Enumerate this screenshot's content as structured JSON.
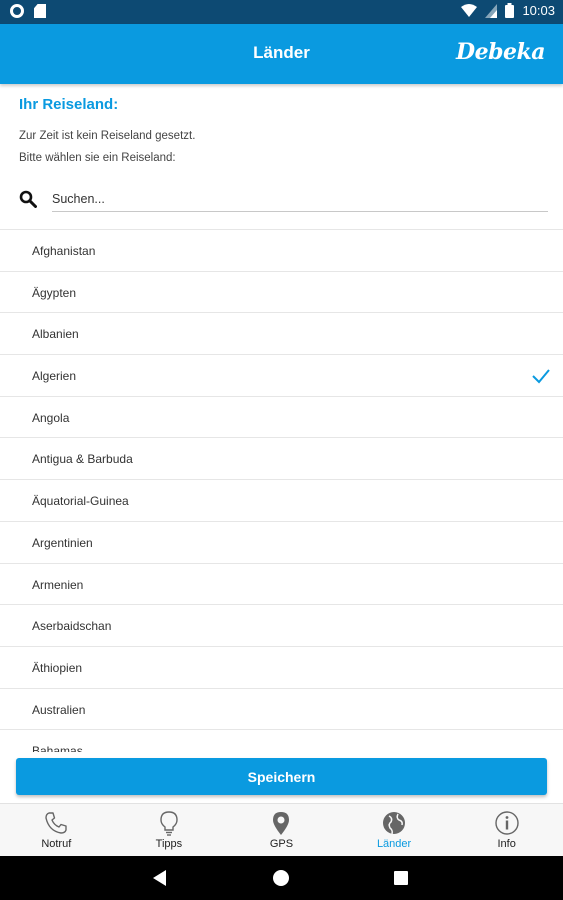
{
  "status_bar": {
    "time": "10:03"
  },
  "app_bar": {
    "title": "Länder",
    "logo": "Debeka"
  },
  "content": {
    "section_title": "Ihr Reiseland:",
    "info_line1": "Zur Zeit ist kein Reiseland gesetzt.",
    "info_line2": "Bitte wählen sie ein Reiseland:",
    "search": {
      "placeholder": "Suchen...",
      "value": ""
    }
  },
  "countries": [
    {
      "name": "Afghanistan",
      "selected": false
    },
    {
      "name": "Ägypten",
      "selected": false
    },
    {
      "name": "Albanien",
      "selected": false
    },
    {
      "name": "Algerien",
      "selected": true
    },
    {
      "name": "Angola",
      "selected": false
    },
    {
      "name": "Antigua & Barbuda",
      "selected": false
    },
    {
      "name": "Äquatorial-Guinea",
      "selected": false
    },
    {
      "name": "Argentinien",
      "selected": false
    },
    {
      "name": "Armenien",
      "selected": false
    },
    {
      "name": "Aserbaidschan",
      "selected": false
    },
    {
      "name": "Äthiopien",
      "selected": false
    },
    {
      "name": "Australien",
      "selected": false
    },
    {
      "name": "Bahamas",
      "selected": false
    }
  ],
  "save_button": {
    "label": "Speichern"
  },
  "bottom_nav": [
    {
      "label": "Notruf",
      "icon": "phone-icon",
      "active": false
    },
    {
      "label": "Tipps",
      "icon": "lightbulb-icon",
      "active": false
    },
    {
      "label": "GPS",
      "icon": "map-pin-icon",
      "active": false
    },
    {
      "label": "Länder",
      "icon": "globe-icon",
      "active": true
    },
    {
      "label": "Info",
      "icon": "info-icon",
      "active": false
    }
  ],
  "colors": {
    "accent": "#0a9ae0",
    "status_bar": "#0d4a73"
  }
}
